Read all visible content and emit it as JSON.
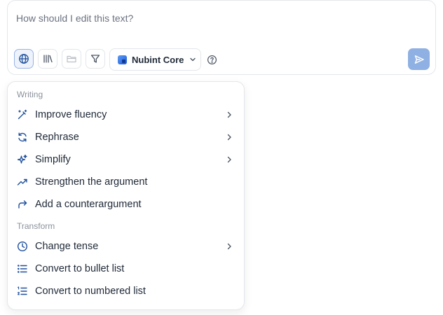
{
  "composer": {
    "placeholder": "How should I edit this text?",
    "model": {
      "name": "Nubint Core"
    }
  },
  "icons": {
    "globe": "globe-icon",
    "library": "library-icon",
    "folder": "folder-icon",
    "filter": "filter-icon",
    "chevron": "chevron-down-icon",
    "help": "help-circle-icon",
    "send": "send-icon"
  },
  "colors": {
    "accent": "#1f5bd8",
    "icon_blue": "#1e4f9c",
    "send_button": "#8fb0e2",
    "active_tool_bg": "#eef3fb"
  },
  "menu": {
    "sections": [
      {
        "label": "Writing",
        "items": [
          {
            "label": "Improve fluency",
            "icon": "magic-wand-icon",
            "submenu": true
          },
          {
            "label": "Rephrase",
            "icon": "refresh-icon",
            "submenu": true
          },
          {
            "label": "Simplify",
            "icon": "sparkles-icon",
            "submenu": true
          },
          {
            "label": "Strengthen the argument",
            "icon": "trending-up-icon",
            "submenu": false
          },
          {
            "label": "Add a counterargument",
            "icon": "redo-arrow-icon",
            "submenu": false
          }
        ]
      },
      {
        "label": "Transform",
        "items": [
          {
            "label": "Change tense",
            "icon": "clock-icon",
            "submenu": true
          },
          {
            "label": "Convert to bullet list",
            "icon": "bullet-list-icon",
            "submenu": false
          },
          {
            "label": "Convert to numbered list",
            "icon": "numbered-list-icon",
            "submenu": false
          }
        ]
      }
    ]
  }
}
